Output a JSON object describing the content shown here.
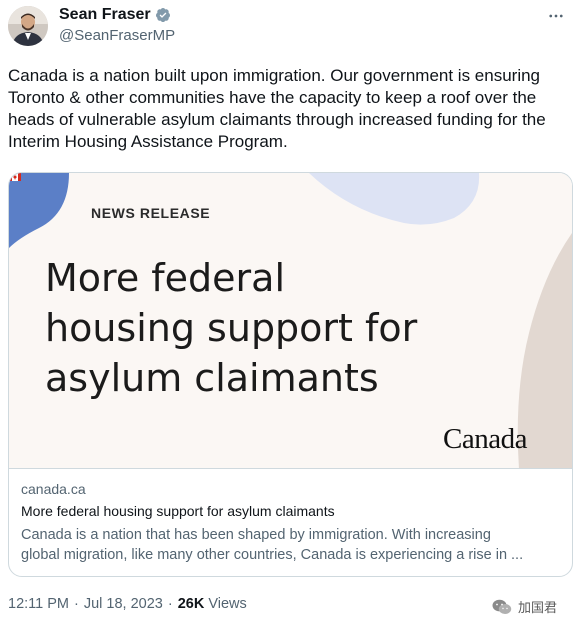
{
  "author": {
    "display_name": "Sean Fraser",
    "handle": "@SeanFraserMP",
    "verified_icon": "verified-badge-icon"
  },
  "tweet": {
    "text": "Canada is a nation built upon immigration. Our government is ensuring Toronto & other communities have the capacity to keep a roof over the heads of vulnerable asylum claimants through increased funding for the Interim Housing Assistance Program."
  },
  "card": {
    "label": "NEWS RELEASE",
    "headline_lines": [
      "More federal",
      "housing support for",
      "asylum claimants"
    ],
    "wordmark": "Canada",
    "domain": "canada.ca",
    "title": "More federal housing support for asylum claimants",
    "description_lines": [
      "Canada is a nation that has been shaped by immigration. With increasing",
      "global migration, like many other countries, Canada is experiencing a rise in ..."
    ]
  },
  "meta": {
    "time": "12:11 PM",
    "date": "Jul 18, 2023",
    "separator": "·",
    "views_count": "26K",
    "views_label": "Views"
  },
  "watermark": {
    "text": "加国君"
  },
  "colors": {
    "text_primary": "#0f1419",
    "text_secondary": "#536471",
    "verified_blue": "#1d9bf0",
    "card_border": "#cfd9de",
    "media_bg": "#fbf7f4",
    "shape_blue": "#5b7fc7",
    "shape_lavender": "#dde3f4",
    "shape_taupe": "#e2d8d1"
  }
}
